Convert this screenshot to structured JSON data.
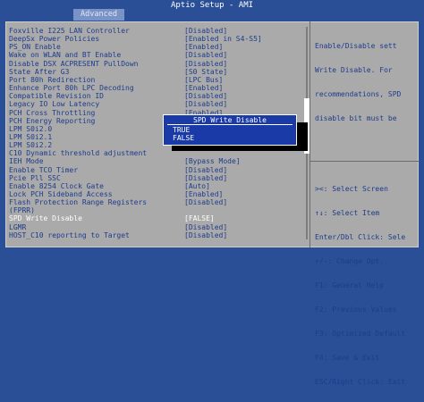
{
  "window": {
    "title": "Aptio Setup - AMI",
    "tab": "Advanced"
  },
  "settings": [
    {
      "label": "Foxville I225 LAN Controller",
      "value": "[Disabled]"
    },
    {
      "label": "DeepSx Power Policies",
      "value": "[Enabled in S4-S5]"
    },
    {
      "label": "PS_ON Enable",
      "value": "[Enabled]"
    },
    {
      "label": "Wake on WLAN and BT Enable",
      "value": "[Disabled]"
    },
    {
      "label": "Disable DSX ACPRESENT PullDown",
      "value": "[Disabled]"
    },
    {
      "label": "State After G3",
      "value": "[S0 State]"
    },
    {
      "label": "Port 80h Redirection",
      "value": "[LPC Bus]"
    },
    {
      "label": "Enhance Port 80h LPC Decoding",
      "value": "[Enabled]"
    },
    {
      "label": "Compatible Revision ID",
      "value": "[Disabled]"
    },
    {
      "label": "Legacy IO Low Latency",
      "value": "[Disabled]"
    },
    {
      "label": "PCH Cross Throttling",
      "value": "[Enabled]"
    },
    {
      "label": "PCH Energy Reporting",
      "value": "[Enabled]"
    },
    {
      "label": "LPM S0i2.0",
      "value": ""
    },
    {
      "label": "LPM S0i2.1",
      "value": ""
    },
    {
      "label": "LPM S0i2.2",
      "value": ""
    },
    {
      "label": "C10 Dynamic threshold adjustment",
      "value": ""
    },
    {
      "label": "IEH Mode",
      "value": "[Bypass Mode]"
    },
    {
      "label": "Enable TCO Timer",
      "value": "[Disabled]"
    },
    {
      "label": "Pcie Pll SSC",
      "value": "[Disabled]"
    },
    {
      "label": "Enable 8254 Clock Gate",
      "value": "[Auto]"
    },
    {
      "label": "Lock PCH Sideband Access",
      "value": "[Enabled]"
    },
    {
      "label": "Flash Protection Range Registers",
      "value": "[Disabled]"
    },
    {
      "label": "(FPRR)",
      "value": ""
    },
    {
      "label": "SPD Write Disable",
      "value": "[FALSE]",
      "selected": true
    },
    {
      "label": "LGMR",
      "value": "[Disabled]"
    },
    {
      "label": "HOST_C10 reporting to Target",
      "value": "[Disabled]"
    }
  ],
  "help_text": [
    "Enable/Disable sett",
    "Write Disable. For",
    "recommendations, SPD",
    "disable bit must be"
  ],
  "key_hints": [
    "><: Select Screen",
    "↑↓: Select Item",
    "Enter/Dbl Click: Sele",
    "+/-: Change Opt.",
    "F1: General Help",
    "F2: Previous Values",
    "F3: Optimized Default",
    "F4: Save & Exit",
    "ESC/Right Click: Exit"
  ],
  "popup": {
    "title": "SPD Write Disable",
    "options": [
      "TRUE",
      "FALSE"
    ],
    "selected": "FALSE"
  }
}
